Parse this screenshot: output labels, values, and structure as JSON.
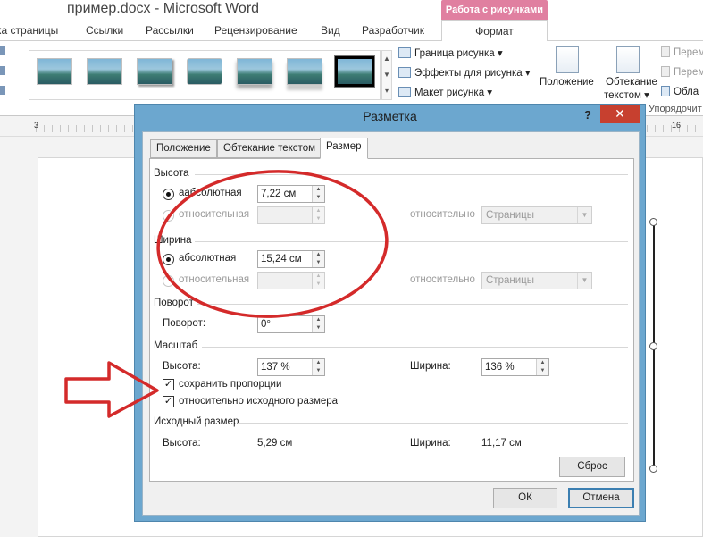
{
  "window": {
    "title": "пример.docx  -  Microsoft Word",
    "context_tab": "Работа с рисунками"
  },
  "ribbon_tabs": [
    {
      "label": "ка страницы"
    },
    {
      "label": "Ссылки"
    },
    {
      "label": "Рассылки"
    },
    {
      "label": "Рецензирование"
    },
    {
      "label": "Вид"
    },
    {
      "label": "Разработчик"
    },
    {
      "label": "Формат"
    }
  ],
  "ribbon": {
    "border_label": "Граница рисунка",
    "effects_label": "Эффекты для рисунка",
    "layout_label": "Макет рисунка",
    "position_label": "Положение",
    "wrap_label_1": "Обтекание",
    "wrap_label_2": "текстом",
    "right_cmd_1": "Перем",
    "right_cmd_2": "Перем",
    "right_cmd_3": "Обла",
    "group_label": "Упорядочит"
  },
  "ruler": {
    "left_num": "3",
    "right_num": "16"
  },
  "dialog": {
    "title": "Разметка",
    "help": "?",
    "close": "✕",
    "tabs": [
      {
        "label": "Положение"
      },
      {
        "label": "Обтекание текстом"
      },
      {
        "label": "Размер"
      }
    ],
    "height": {
      "section": "Высота",
      "absolute_label": "абсолютная",
      "absolute_value": "7,22 см",
      "relative_label": "относительная",
      "relative_value": "",
      "relative_to_label": "относительно",
      "relative_to_value": "Страницы"
    },
    "width": {
      "section": "Ширина",
      "absolute_label": "абсолютная",
      "absolute_value": "15,24 см",
      "relative_label": "относительная",
      "relative_value": "",
      "relative_to_label": "относительно",
      "relative_to_value": "Страницы"
    },
    "rotation": {
      "section": "Поворот",
      "label": "Поворот:",
      "value": "0°"
    },
    "scale": {
      "section": "Масштаб",
      "height_label": "Высота:",
      "height_value": "137 %",
      "width_label": "Ширина:",
      "width_value": "136 %",
      "lock_aspect_label": "сохранить пропорции",
      "lock_aspect_checked": true,
      "relative_original_label": "относительно исходного размера",
      "relative_original_checked": true
    },
    "original": {
      "section": "Исходный размер",
      "height_label": "Высота:",
      "height_value": "5,29 см",
      "width_label": "Ширина:",
      "width_value": "11,17 см"
    },
    "reset_label": "Сброс",
    "ok_label": "ОК",
    "cancel_label": "Отмена"
  },
  "colors": {
    "dialog_frame": "#6ca7cf",
    "context_tab": "#e07fa0",
    "close_button": "#c7402f",
    "annotation_red": "#d42a2a"
  }
}
